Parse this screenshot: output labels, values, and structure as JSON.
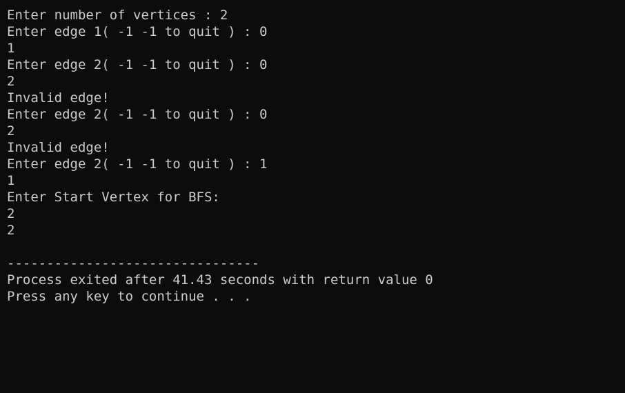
{
  "console": {
    "lines": [
      "Enter number of vertices : 2",
      "Enter edge 1( -1 -1 to quit ) : 0",
      "1",
      "Enter edge 2( -1 -1 to quit ) : 0",
      "2",
      "Invalid edge!",
      "Enter edge 2( -1 -1 to quit ) : 0",
      "2",
      "Invalid edge!",
      "Enter edge 2( -1 -1 to quit ) : 1",
      "1",
      "Enter Start Vertex for BFS:",
      "2",
      "2",
      "",
      "--------------------------------",
      "Process exited after 41.43 seconds with return value 0",
      "Press any key to continue . . ."
    ]
  },
  "colors": {
    "background": "#0c0c0c",
    "text": "#cccccc"
  }
}
